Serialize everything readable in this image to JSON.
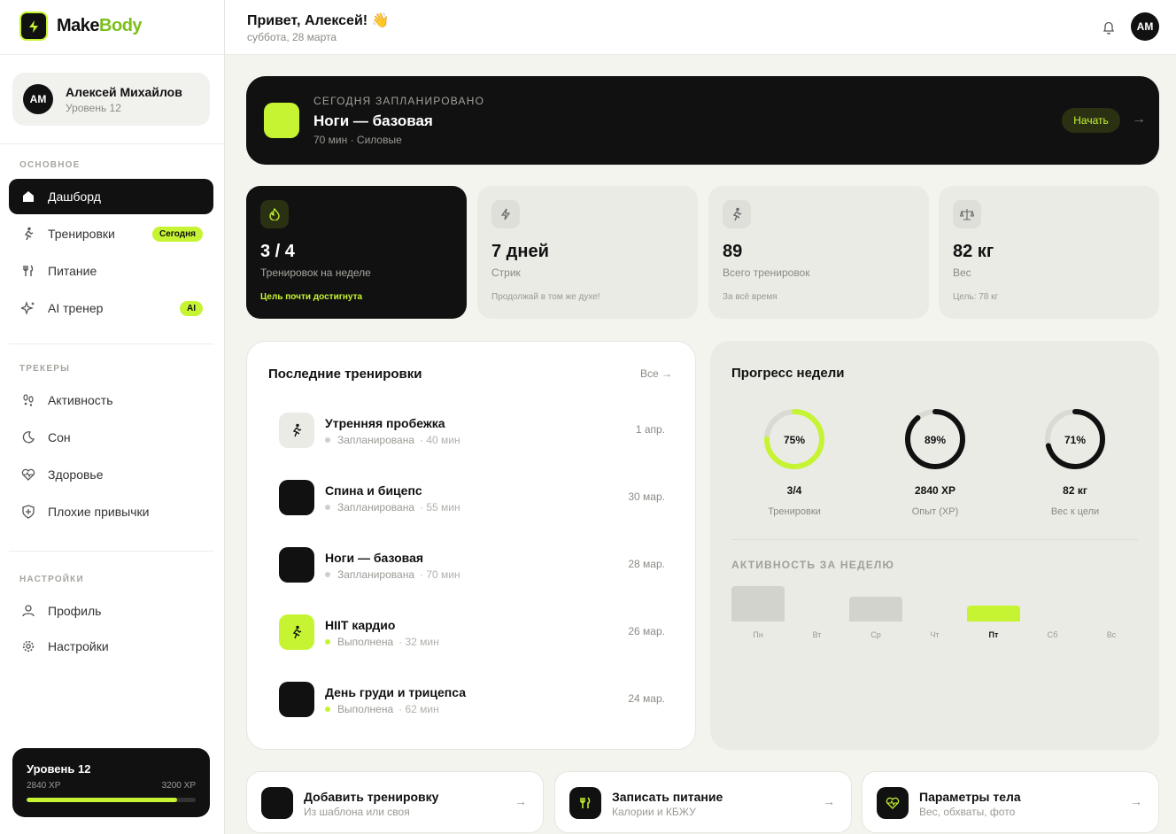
{
  "app": {
    "name_part1": "Make",
    "name_part2": "Body"
  },
  "user": {
    "name": "Алексей Михайлов",
    "level": "Уровень 12",
    "initials": "АМ"
  },
  "nav": {
    "section_main": "ОСНОВНОЕ",
    "section_trackers": "ТРЕКЕРЫ",
    "section_settings": "НАСТРОЙКИ",
    "items": [
      {
        "label": "Дашборд"
      },
      {
        "label": "Тренировки",
        "badge": "Сегодня"
      },
      {
        "label": "Питание"
      },
      {
        "label": "AI тренер",
        "badge": "AI"
      },
      {
        "label": "Активность"
      },
      {
        "label": "Сон"
      },
      {
        "label": "Здоровье"
      },
      {
        "label": "Плохие привычки"
      },
      {
        "label": "Профиль"
      },
      {
        "label": "Настройки"
      }
    ]
  },
  "level_card": {
    "title": "Уровень 12",
    "current_xp": "2840 XP",
    "max_xp": "3200 XP",
    "progress": 0.89
  },
  "header": {
    "greeting": "Привет, Алексей! 👋",
    "date": "суббота, 28 марта"
  },
  "today": {
    "kicker": "СЕГОДНЯ ЗАПЛАНИРОВАНО",
    "title": "Ноги — базовая",
    "meta": "70 мин · Силовые",
    "button": "Начать"
  },
  "stats": [
    {
      "value": "3 / 4",
      "label": "Тренировок на неделе",
      "note": "Цель почти достигнута",
      "icon": "flame-icon"
    },
    {
      "value": "7 дней",
      "label": "Стрик",
      "note": "Продолжай в том же духе!",
      "icon": "bolt-icon"
    },
    {
      "value": "89",
      "label": "Всего тренировок",
      "note": "За всё время",
      "icon": "runner-icon"
    },
    {
      "value": "82 кг",
      "label": "Вес",
      "note": "Цель: 78 кг",
      "icon": "scale-icon"
    }
  ],
  "recent": {
    "title": "Последние тренировки",
    "all_link": "Все →",
    "items": [
      {
        "name": "Утренняя пробежка",
        "status": "Запланирована",
        "duration": "· 40 мин",
        "date": "1 апр."
      },
      {
        "name": "Спина и бицепс",
        "status": "Запланирована",
        "duration": "· 55 мин",
        "date": "30 мар."
      },
      {
        "name": "Ноги — базовая",
        "status": "Запланирована",
        "duration": "· 70 мин",
        "date": "28 мар."
      },
      {
        "name": "HIIT кардио",
        "status": "Выполнена",
        "duration": "· 32 мин",
        "date": "26 мар."
      },
      {
        "name": "День груди и трицепса",
        "status": "Выполнена",
        "duration": "· 62 мин",
        "date": "24 мар."
      }
    ]
  },
  "week_progress": {
    "title": "Прогресс недели",
    "rings": [
      {
        "percent": "75%",
        "fraction": 0.75,
        "value": "3/4",
        "label": "Тренировки",
        "color": "#c6f432"
      },
      {
        "percent": "89%",
        "fraction": 0.89,
        "value": "2840 XP",
        "label": "Опыт (XP)",
        "color": "#111111"
      },
      {
        "percent": "71%",
        "fraction": 0.71,
        "value": "82 кг",
        "label": "Вес к цели",
        "color": "#111111"
      }
    ],
    "activity_title": "АКТИВНОСТЬ ЗА НЕДЕЛЮ",
    "days": [
      {
        "label": "Пн",
        "level": 1.0
      },
      {
        "label": "Вт",
        "level": 0
      },
      {
        "label": "Ср",
        "level": 0.7
      },
      {
        "label": "Чт",
        "level": 0
      },
      {
        "label": "Пт",
        "level": 0.45,
        "today": true
      },
      {
        "label": "Сб",
        "level": 0
      },
      {
        "label": "Вс",
        "level": 0
      }
    ]
  },
  "quick_actions": [
    {
      "title": "Добавить тренировку",
      "subtitle": "Из шаблона или своя"
    },
    {
      "title": "Записать питание",
      "subtitle": "Калории и КБЖУ"
    },
    {
      "title": "Параметры тела",
      "subtitle": "Вес, обхваты, фото"
    }
  ],
  "colors": {
    "accent": "#c6f432",
    "dark": "#111111",
    "background": "#f4f4ef"
  }
}
